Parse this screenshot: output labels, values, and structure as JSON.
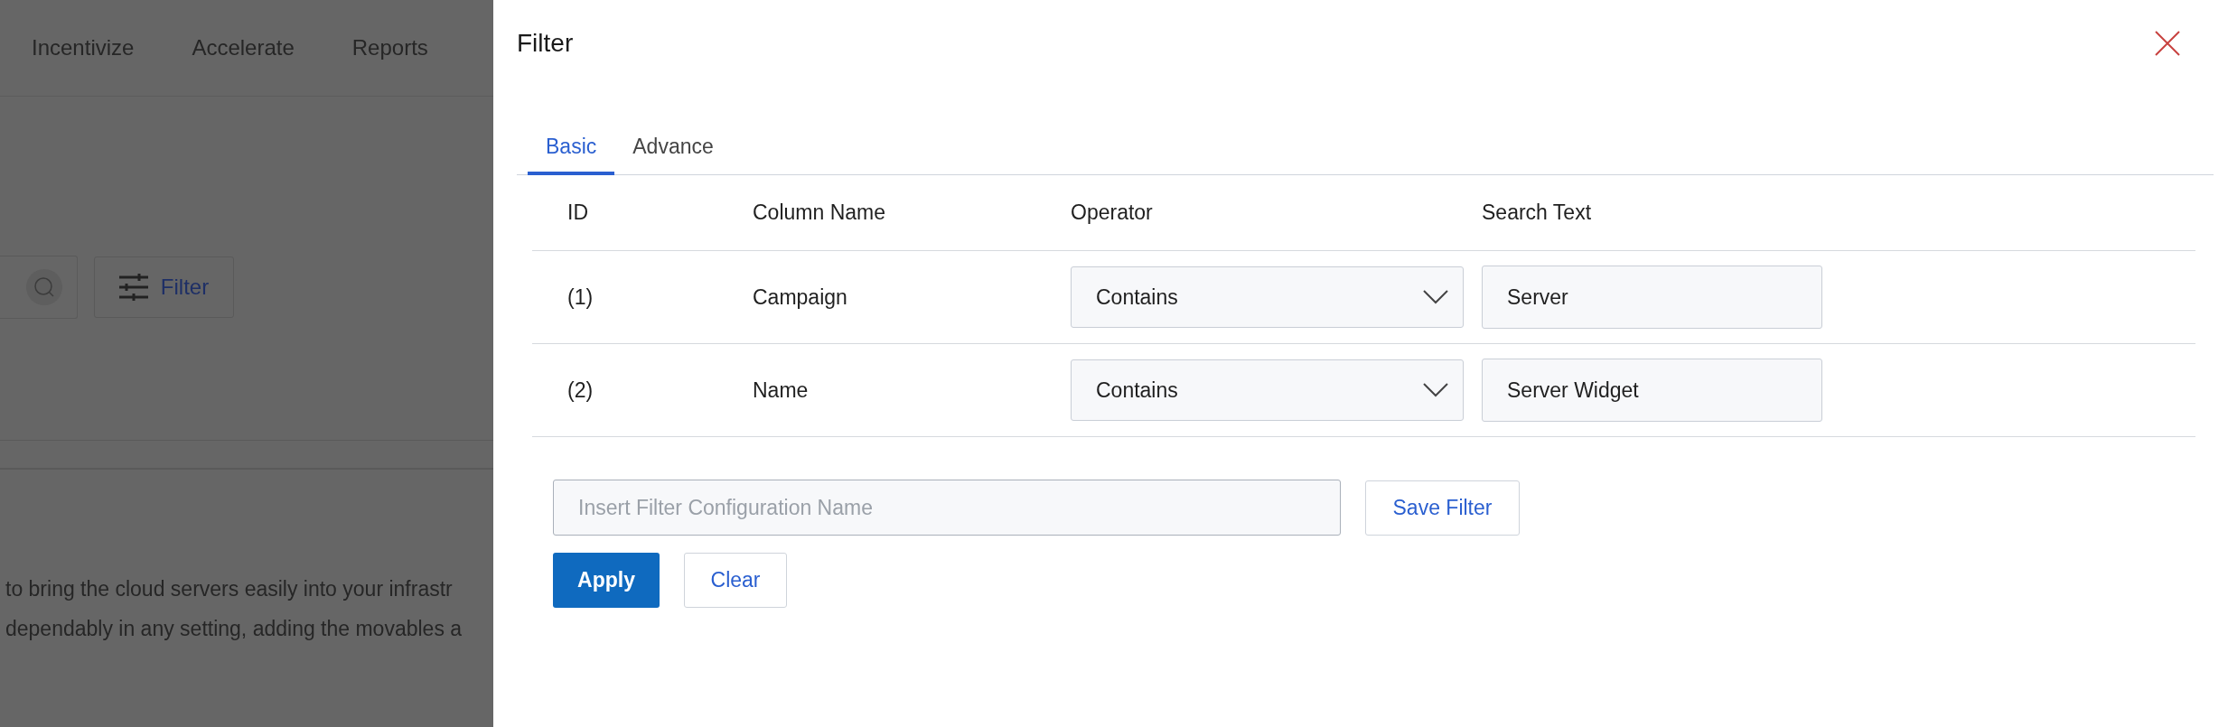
{
  "background_page": {
    "nav_items": [
      "Incentivize",
      "Accelerate",
      "Reports"
    ],
    "filter_button": "Filter",
    "description_lines": [
      "to bring the cloud servers easily into your infrastr",
      "dependably in any setting, adding the movables a"
    ]
  },
  "filter_panel": {
    "title": "Filter",
    "tabs": [
      {
        "label": "Basic",
        "selected": true
      },
      {
        "label": "Advance",
        "selected": false
      }
    ],
    "table": {
      "columns": [
        "ID",
        "Column Name",
        "Operator",
        "Search Text"
      ],
      "rows": [
        {
          "id": "(1)",
          "column_name": "Campaign",
          "operator": "Contains",
          "search_text": "Server"
        },
        {
          "id": "(2)",
          "column_name": "Name",
          "operator": "Contains",
          "search_text": "Server Widget"
        }
      ]
    },
    "config_name": {
      "placeholder": "Insert Filter Configuration Name"
    },
    "buttons": {
      "save": "Save Filter",
      "apply": "Apply",
      "clear": "Clear"
    }
  }
}
